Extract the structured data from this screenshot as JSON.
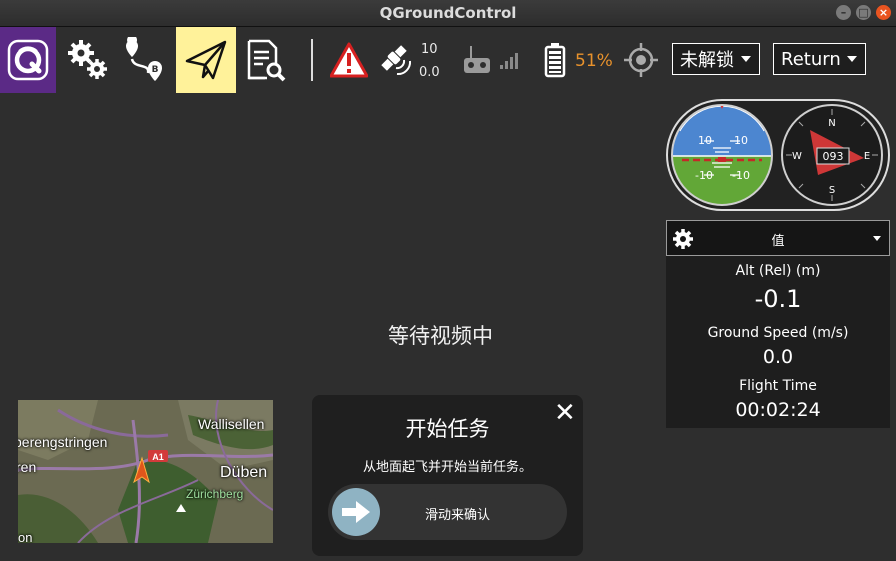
{
  "window": {
    "title": "QGroundControl",
    "minimize": "–",
    "maximize": "□",
    "close": "×"
  },
  "toolbar": {
    "satellite_count": "10",
    "hdop": "0.0",
    "battery_percent": "51%",
    "arm_status": "未解锁",
    "flight_mode": "Return",
    "icons": [
      "qgc-logo-icon",
      "settings-gears-icon",
      "plan-route-icon",
      "fly-paper-plane-icon",
      "analyze-log-icon",
      "warning-icon",
      "gps-satellite-icon",
      "rc-transmitter-icon",
      "signal-bars-icon",
      "battery-icon",
      "gimbal-target-icon"
    ],
    "colors": {
      "qgc_bg": "#5b2a86",
      "fly_active_bg": "#fff29a",
      "battery_text": "#e8922c",
      "warning": "#d62020"
    }
  },
  "video": {
    "message": "等待视频中"
  },
  "instruments": {
    "attitude": {
      "pitch_labels": [
        "10",
        "10",
        "-10",
        "-10"
      ]
    },
    "compass": {
      "heading": "093",
      "cardinals": [
        "N",
        "E",
        "S",
        "W"
      ]
    }
  },
  "values_panel": {
    "header": "值",
    "items": [
      {
        "label": "Alt (Rel) (m)",
        "value": "-0.1"
      },
      {
        "label": "Ground Speed (m/s)",
        "value": "0.0"
      },
      {
        "label": "Flight Time",
        "value": "00:02:24"
      }
    ]
  },
  "map": {
    "labels": [
      "berengstringen",
      "Wallisellen",
      "ren",
      "Düben",
      "Zürichberg",
      "on"
    ],
    "road_badge": "A1"
  },
  "confirm": {
    "title": "开始任务",
    "message": "从地面起飞并开始当前任务。",
    "slider_label": "滑动来确认",
    "close": "✕"
  }
}
